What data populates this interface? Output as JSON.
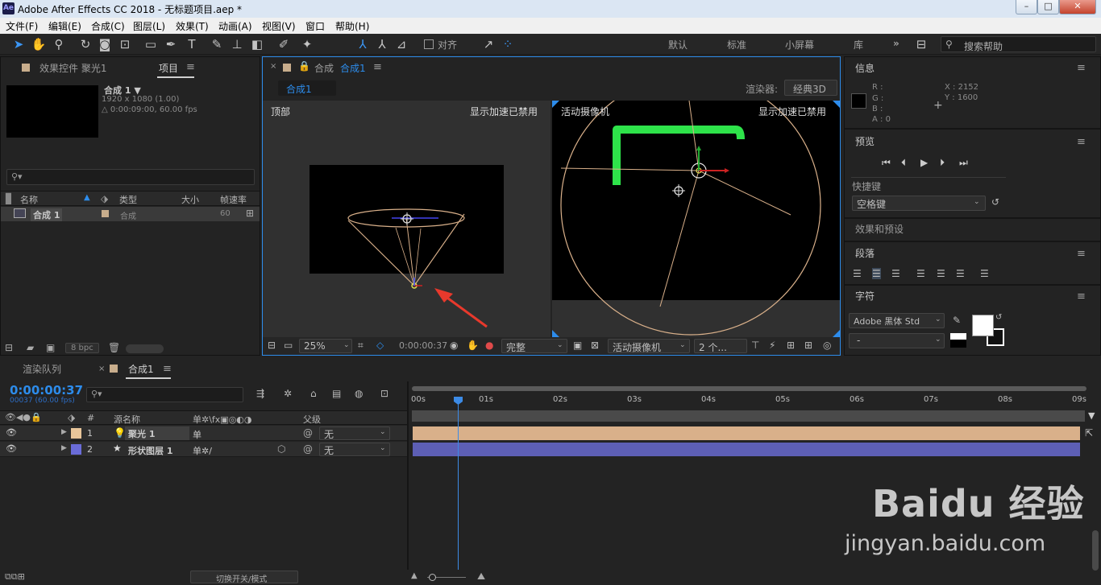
{
  "window": {
    "title": "Adobe After Effects CC 2018 - 无标题项目.aep *",
    "app_icon": "Ae",
    "minimize": "–",
    "maximize": "□",
    "close": "✕"
  },
  "menu": [
    "文件(F)",
    "编辑(E)",
    "合成(C)",
    "图层(L)",
    "效果(T)",
    "动画(A)",
    "视图(V)",
    "窗口",
    "帮助(H)"
  ],
  "toolbar": {
    "align_label": "对齐",
    "workspaces": [
      "默认",
      "标准",
      "小屏幕",
      "库"
    ],
    "more": "»",
    "search_help_placeholder": "搜索帮助"
  },
  "project_panel": {
    "tab_effects": "效果控件 聚光1",
    "tab_project": "项目",
    "menu": "≡",
    "comp_name": "合成 1 ▼",
    "comp_size": "1920 x 1080 (1.00)",
    "comp_duration": "△ 0:00:09:00, 60.00 fps",
    "search_icon_text": "⚲▾",
    "columns": [
      "名称",
      "类型",
      "大小",
      "帧速率"
    ],
    "items": [
      {
        "name": "合成 1",
        "type": "合成",
        "size": "",
        "fps": "60"
      }
    ],
    "bpc": "8 bpc"
  },
  "comp_panel": {
    "tab_label": "合成",
    "tab_name": "合成1",
    "menu": "≡",
    "sub_tab": "合成1",
    "renderer_label": "渲染器:",
    "renderer_value": "经典3D",
    "view_left_name": "顶部",
    "view_left_status": "显示加速已禁用",
    "view_right_name": "活动摄像机",
    "view_right_status": "显示加速已禁用",
    "zoom": "25%",
    "timecode": "0:00:00:37",
    "resolution": "完整",
    "camera": "活动摄像机",
    "views": "2 个..."
  },
  "info_panel": {
    "title": "信息",
    "r": "R :",
    "g": "G :",
    "b": "B :",
    "a": "A : 0",
    "x": "X : 2152",
    "y": "Y : 1600"
  },
  "preview_panel": {
    "title": "预览",
    "shortcut_label": "快捷键",
    "shortcut_value": "空格键"
  },
  "effects_presets": {
    "title": "效果和预设"
  },
  "paragraph_panel": {
    "title": "段落"
  },
  "character_panel": {
    "title": "字符",
    "font": "Adobe 黑体 Std",
    "style": "-"
  },
  "timeline": {
    "tab_render_queue": "渲染队列",
    "tab_comp": "合成1",
    "menu": "≡",
    "timecode": "0:00:00:37",
    "frame_info": "00037 (60.00 fps)",
    "columns": {
      "num": "#",
      "source_name": "源名称",
      "switches": "单✲\\fx▣◎◐◑",
      "parent": "父级"
    },
    "layers": [
      {
        "num": "1",
        "name": "聚光 1",
        "switch": "单",
        "parent": "无",
        "color": "#e8c59a",
        "bar_color": "#d9b08a"
      },
      {
        "num": "2",
        "name": "形状图层 1",
        "switch": "单✲/",
        "parent": "无",
        "color": "#6a6cd8",
        "bar_color": "#5d5fb5"
      }
    ],
    "ruler": [
      "00s",
      "01s",
      "02s",
      "03s",
      "04s",
      "05s",
      "06s",
      "07s",
      "08s",
      "09s"
    ],
    "playhead_time_fraction": 0.0685,
    "toggle_label": "切换开关/模式"
  },
  "watermark": {
    "brand": "Baidu 经验",
    "url": "jingyan.baidu.com"
  },
  "colors": {
    "accent_blue": "#2d8ceb",
    "light_green": "#2ee34a",
    "camera_wire": "#d9b08a",
    "arrow_red": "#e8392c"
  }
}
